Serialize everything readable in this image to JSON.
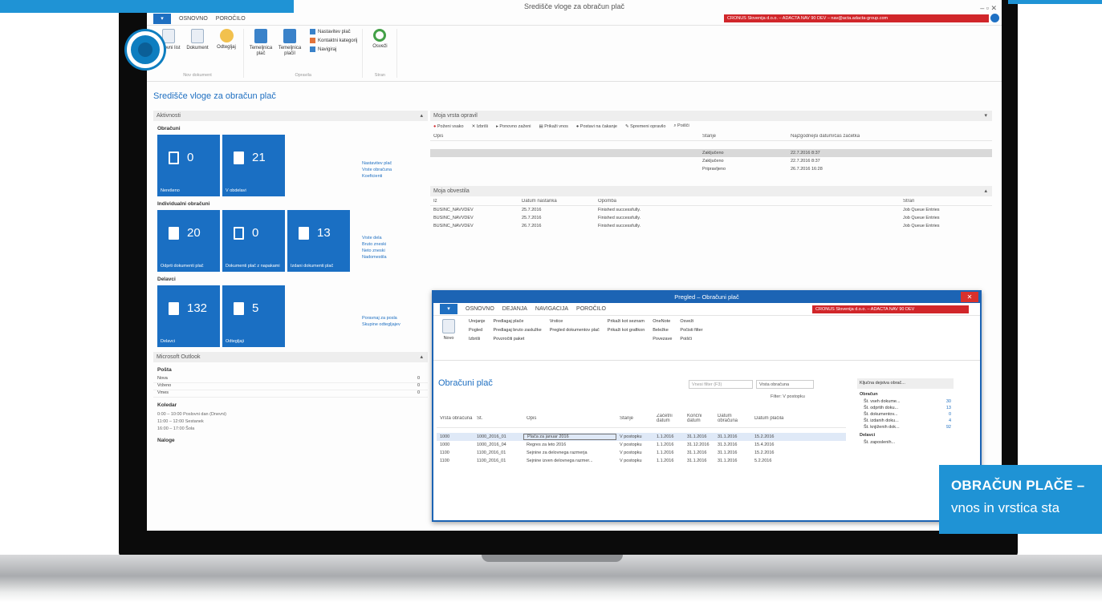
{
  "promo": {
    "top_banner": "",
    "title": "OBRAČUN PLAČE",
    "dash": "–",
    "subtitle": "vnos in vrstica sta"
  },
  "window": {
    "title": "Središče vloge za obračun plač",
    "controls": "–  ▫  ✕",
    "file_tab": "▾",
    "tabs": [
      "OSNOVNO",
      "POROČILO"
    ],
    "red_bar": "CRONUS Slovenija d.o.o. – ADACTA NAV 90 DEV – nav@acta.adacta-group.com"
  },
  "ribbon": {
    "groups": [
      {
        "name": "Nov dokument",
        "buttons": [
          "Delovni list",
          "Dokument",
          "Odtegljaj"
        ]
      },
      {
        "name": "Opravila",
        "buttons": [
          "Temeljnica plač",
          "Temeljnica plačil"
        ],
        "small": [
          "Nastavitev plač",
          "Kontaktni kategorij",
          "Navigiraj"
        ]
      },
      {
        "name": "Stran",
        "buttons": [
          "Osveži"
        ]
      }
    ]
  },
  "page_title": "Središče vloge za obračun plač",
  "activities": {
    "header": "Aktivnosti",
    "sections": [
      {
        "label": "Obračuni",
        "tiles": [
          {
            "value": "0",
            "label": "Nerešeno"
          },
          {
            "value": "21",
            "label": "V obdelavi"
          }
        ],
        "links": [
          "Nastavitev plač",
          "Vrste obračuna",
          "Koeficienti"
        ]
      },
      {
        "label": "Individualni obračuni",
        "tiles": [
          {
            "value": "20",
            "label": "Odprti dokumenti plač"
          },
          {
            "value": "0",
            "label": "Dokumenti plač z napakami"
          },
          {
            "value": "13",
            "label": "Izdani dokumenti plač"
          }
        ],
        "links": [
          "Vrste dela",
          "Bruto zneski",
          "Neto zneski",
          "Nadomestila"
        ]
      },
      {
        "label": "Delavci",
        "tiles": [
          {
            "value": "132",
            "label": "Delavci"
          },
          {
            "value": "5",
            "label": "Odtegljaji"
          }
        ],
        "links": [
          "Poravnaj za posla",
          "Skupine odtegljajev"
        ]
      }
    ]
  },
  "outlook": {
    "header": "Microsoft Outlook",
    "mail_label": "Pošta",
    "mail": [
      {
        "name": "Nova",
        "count": "0"
      },
      {
        "name": "Vrženo",
        "count": "0"
      },
      {
        "name": "Vmes",
        "count": "0"
      }
    ],
    "calendar_label": "Koledar",
    "calendar": [
      "0:00 – 10:00   Poslovni dan (Dnevni)",
      "11:00 – 12:00   Sestanek",
      "16:00 – 17:00   Šola"
    ],
    "tasks_label": "Naloge"
  },
  "queue": {
    "header": "Moja vrsta opravil",
    "actions": [
      "Poženi vsako",
      "Izbriši",
      "Ponovno zaženi",
      "Prikaži vnos",
      "Postavi na čakanje",
      "Spremeni opravilo",
      "Poišči"
    ],
    "columns": [
      "Opis",
      "Stanje",
      "Najzgodnejši datum/čas začetka"
    ],
    "rows": [
      {
        "desc": "",
        "status": "",
        "date": ""
      },
      {
        "desc": "",
        "status": "Zaključeno",
        "date": "22.7.2016 8:37"
      },
      {
        "desc": "",
        "status": "Zaključeno",
        "date": "22.7.2016 8:37"
      },
      {
        "desc": "",
        "status": "Pripravljeno",
        "date": "26.7.2016 16:28"
      }
    ]
  },
  "notes": {
    "header": "Moja obvestila",
    "columns": [
      "Iz",
      "Datum nastanka",
      "Opomba",
      "Stran"
    ],
    "rows": [
      {
        "from": "BUSINC_NAVVDEV",
        "date": "25.7.2016",
        "note": "Finished successfully.",
        "page": "Job Queue Entries"
      },
      {
        "from": "BUSINC_NAVVDEV",
        "date": "25.7.2016",
        "note": "Finished successfully.",
        "page": "Job Queue Entries"
      },
      {
        "from": "BUSINC_NAVVDEV",
        "date": "26.7.2016",
        "note": "Finished successfully.",
        "page": "Job Queue Entries"
      }
    ]
  },
  "popup": {
    "title": "Pregled – Obračuni plač",
    "tabs": [
      "OSNOVNO",
      "DEJANJA",
      "NAVIGACIJA",
      "POROČILO"
    ],
    "red_bar": "CRONUS Slovenija d.o.o. – ADACTA NAV 90 DEV",
    "ribbon": {
      "new": "Novo",
      "manage": [
        "Urejanje",
        "Pogled",
        "Izbriši"
      ],
      "process": [
        "Predlagaj plače",
        "Predlagaj bruto zaslužke",
        "Povzročiti paket"
      ],
      "pregled": [
        "Vrstice",
        "Pregled dokumentov plač"
      ],
      "prikazi": [
        "Prikaži kot seznam",
        "Prikaži kot grafikon"
      ],
      "note": [
        "OneNote",
        "Beležke",
        "Povezave"
      ],
      "page": [
        "Osveži",
        "Počisti filter",
        "Poišči"
      ]
    },
    "title_main": "Obračuni plač",
    "search_placeholder": "Vnesi filter (F3)",
    "filter_select": "Vrsta obračuna",
    "filter_label": "Filter: V postopku",
    "columns": [
      "Vrsta obračuna",
      "Št.",
      "Opis",
      "Stanje",
      "Začetni datum",
      "Končni datum",
      "Datum obračuna",
      "Datum plačila"
    ],
    "rows": [
      [
        "1000",
        "1000_2016_01",
        "Plača za januar 2016",
        "V postopku",
        "1.1.2016",
        "31.1.2016",
        "31.1.2016",
        "15.2.2016"
      ],
      [
        "1000",
        "1000_2016_04",
        "Regres za leto 2016",
        "V postopku",
        "1.1.2016",
        "31.12.2016",
        "31.3.2016",
        "15.4.2016"
      ],
      [
        "1100",
        "1100_2016_01",
        "Sejnine za delovnega razmerja",
        "V postopku",
        "1.1.2016",
        "31.1.2016",
        "31.1.2016",
        "15.2.2016"
      ],
      [
        "1100",
        "1100_2016_01",
        "Sejnine izven delovnega razmer...",
        "V postopku",
        "1.1.2016",
        "31.1.2016",
        "31.1.2016",
        "5.2.2016"
      ]
    ],
    "factbox_title": "Ključna dejstva obrač...",
    "factbox_sections": [
      {
        "label": "Obračun",
        "items": [
          [
            "Št. vseh dokume...",
            "30"
          ],
          [
            "Št. odprtih doku...",
            "13"
          ],
          [
            "Št. dokumentov...",
            "0"
          ],
          [
            "Št. izdanih doku...",
            "4"
          ],
          [
            "Št. knjiženih dok...",
            "92"
          ]
        ]
      },
      {
        "label": "Delavci",
        "items": [
          [
            "Št. zaposlenih...",
            ""
          ]
        ]
      }
    ]
  }
}
